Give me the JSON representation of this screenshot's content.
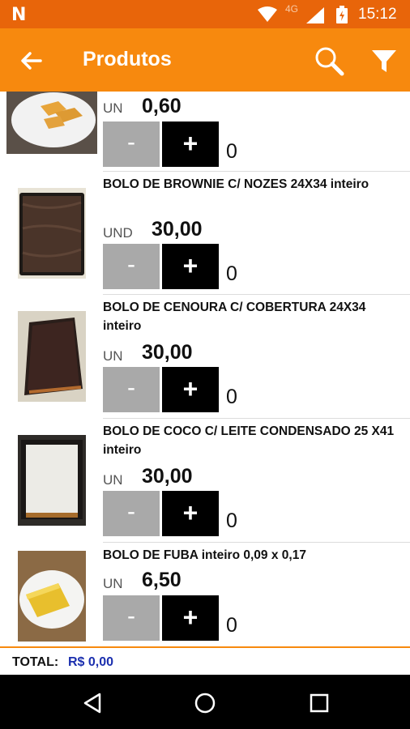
{
  "status_bar": {
    "time": "15:12",
    "network": "4G",
    "app_icon": "N"
  },
  "app_bar": {
    "title": "Produtos",
    "back_icon": "arrow-back-icon",
    "search_icon": "search-icon",
    "filter_icon": "filter-icon"
  },
  "colors": {
    "status_bar": "#e8650a",
    "app_bar": "#f7890e",
    "minus_button": "#a9a9a9",
    "plus_button": "#000000",
    "total_value": "#1b2fae"
  },
  "buttons": {
    "minus": "-",
    "plus": "+"
  },
  "items": [
    {
      "name": "",
      "unit": "UN",
      "price": "0,60",
      "qty": "0"
    },
    {
      "name": "BOLO DE BROWNIE C/ NOZES 24X34 inteiro",
      "unit": "UND",
      "price": "30,00",
      "qty": "0"
    },
    {
      "name": "BOLO DE CENOURA C/ COBERTURA 24X34 inteiro",
      "unit": "UN",
      "price": "30,00",
      "qty": "0"
    },
    {
      "name": "BOLO DE COCO C/ LEITE CONDENSADO 25 X41 inteiro",
      "unit": "UN",
      "price": "30,00",
      "qty": "0"
    },
    {
      "name": "BOLO DE FUBA inteiro 0,09 x 0,17",
      "unit": "UN",
      "price": "6,50",
      "qty": "0"
    }
  ],
  "total": {
    "label": "TOTAL:",
    "value": "R$ 0,00"
  }
}
